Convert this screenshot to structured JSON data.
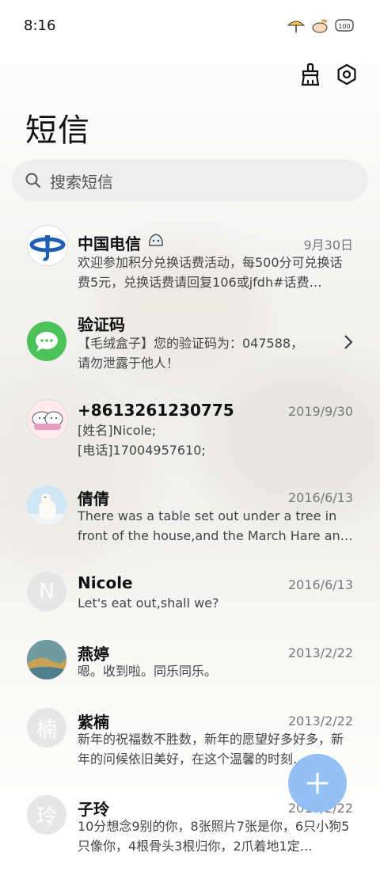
{
  "status": {
    "time": "8:16",
    "battery": "100"
  },
  "header": {
    "title": "短信"
  },
  "search": {
    "placeholder": "搜索短信"
  },
  "messages": [
    {
      "name": "中国电信",
      "date": "9月30日",
      "preview": "欢迎参加积分兑换话费活动，每500分可兑换话费5元，兑换话费请回复106或jfdh#话费…"
    },
    {
      "name": "验证码",
      "date": "",
      "preview": "【毛绒盒子】您的验证码为：047588，请勿泄露于他人！"
    },
    {
      "name": "+8613261230775",
      "date": "2019/9/30",
      "preview_lines": [
        "[姓名]Nicole;",
        "[电话]17004957610;"
      ]
    },
    {
      "name": "倩倩",
      "date": "2016/6/13",
      "preview": "There was a table set out under a tree in front of the house,and the March Hare an…"
    },
    {
      "name": "Nicole",
      "date": "2016/6/13",
      "preview": "Let's eat out,shall we?",
      "initial": "N"
    },
    {
      "name": "燕婷",
      "date": "2013/2/22",
      "preview": "嗯。收到啦。同乐同乐。"
    },
    {
      "name": "紫楠",
      "date": "2013/2/22",
      "preview": "新年的祝福数不胜数，新年的愿望好多好多，新年的问候依旧美好，在这个温馨的时刻…",
      "initial": "楠"
    },
    {
      "name": "子玲",
      "date": "2013/2/22",
      "preview": "10分想念9别的你，8张照片7张是你，6只小狗5只像你，4根骨头3根归你，2爪着地1定…",
      "initial": "玲"
    }
  ],
  "colors": {
    "fab": "#8fbdf4",
    "sms_green": "#4cc35a",
    "telecom_blue": "#1e5fb4"
  }
}
